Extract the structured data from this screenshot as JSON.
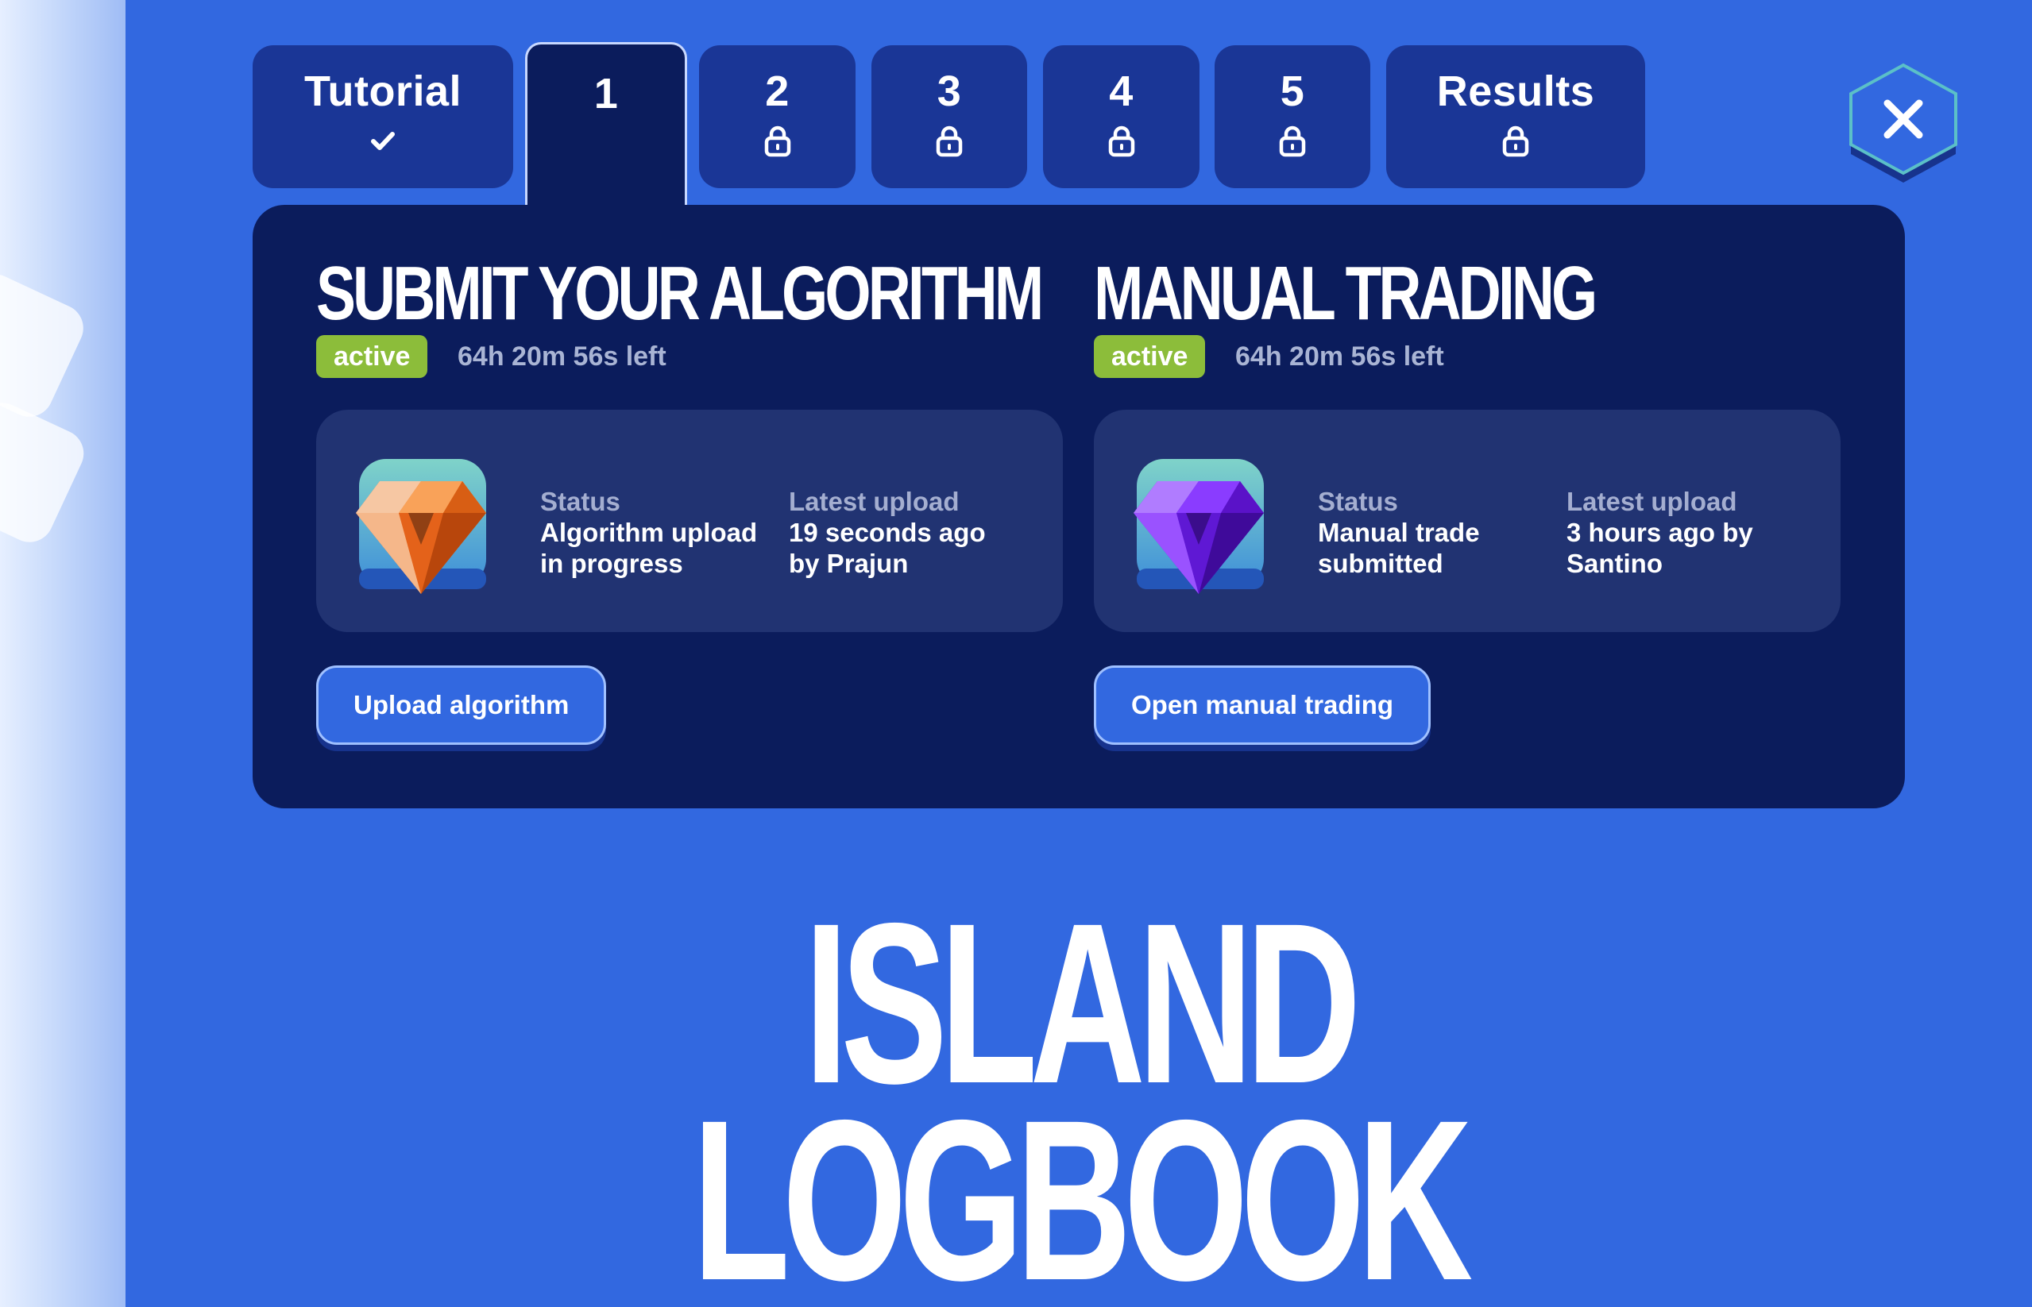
{
  "tabs": [
    {
      "label": "Tutorial",
      "state": "completed",
      "icon": "check-icon"
    },
    {
      "label": "1",
      "state": "active",
      "icon": ""
    },
    {
      "label": "2",
      "state": "locked",
      "icon": "lock-icon"
    },
    {
      "label": "3",
      "state": "locked",
      "icon": "lock-icon"
    },
    {
      "label": "4",
      "state": "locked",
      "icon": "lock-icon"
    },
    {
      "label": "5",
      "state": "locked",
      "icon": "lock-icon"
    },
    {
      "label": "Results",
      "state": "locked",
      "icon": "lock-icon"
    }
  ],
  "close_button": {
    "icon": "close-icon"
  },
  "algorithm": {
    "title": "SUBMIT YOUR ALGORITHM",
    "badge": "active",
    "time_left": "64h 20m 56s left",
    "gem_icon": "orange-gem-icon",
    "status_label": "Status",
    "status_value": "Algorithm upload\nin progress",
    "upload_label": "Latest upload",
    "upload_value": "19 seconds ago\nby Prajun",
    "button_label": "Upload algorithm"
  },
  "manual": {
    "title": "MANUAL TRADING",
    "badge": "active",
    "time_left": "64h 20m 56s left",
    "gem_icon": "purple-gem-icon",
    "status_label": "Status",
    "status_value": "Manual trade\nsubmitted",
    "upload_label": "Latest upload",
    "upload_value": "3 hours ago by\nSantino",
    "button_label": "Open manual trading"
  },
  "logbook": {
    "line1": "ISLAND",
    "line2": "LOGBOOK"
  },
  "colors": {
    "background": "#3268e0",
    "panel": "#0b1c5c",
    "tab": "#1a3696",
    "card": "#213372",
    "badge": "#8cbd3a"
  }
}
